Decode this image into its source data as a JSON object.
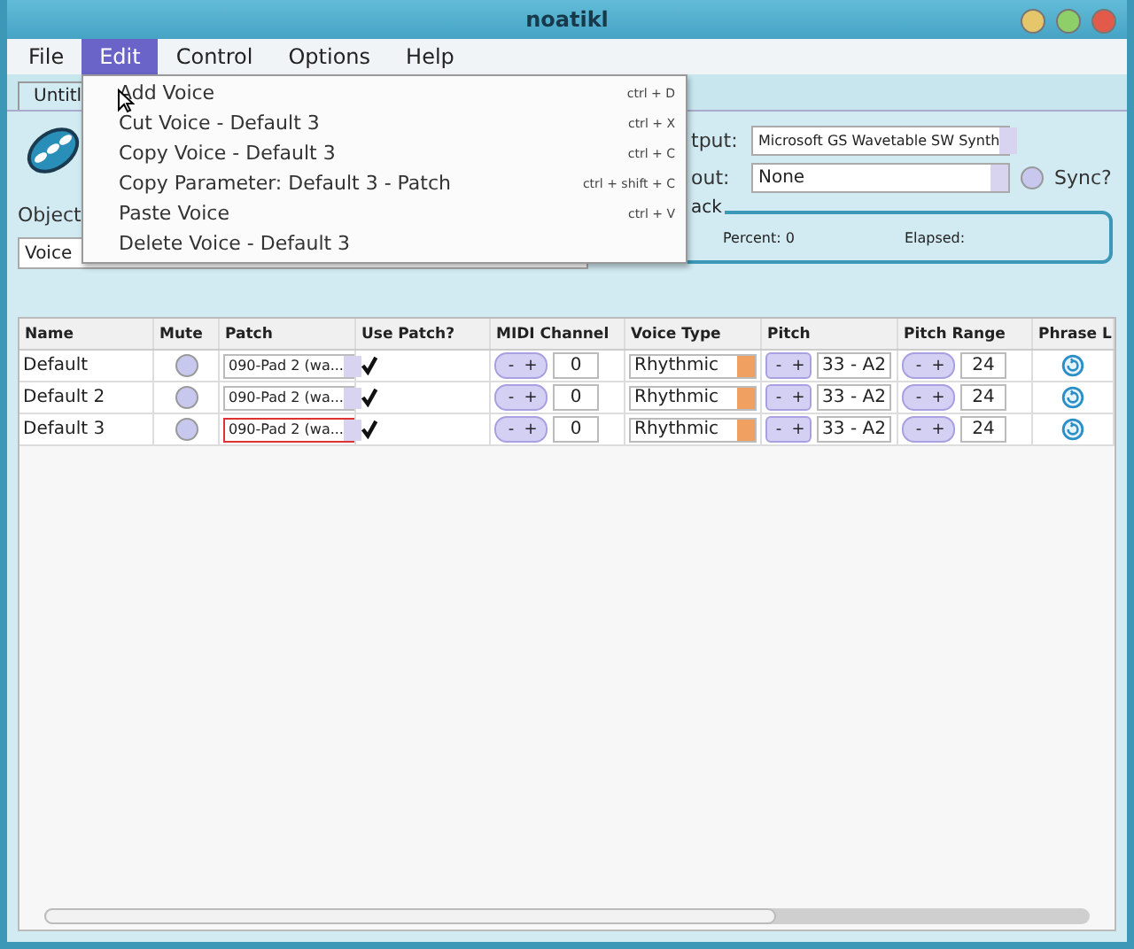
{
  "window": {
    "title": "noatikl"
  },
  "menu_bar": [
    {
      "label": "File",
      "selected": false
    },
    {
      "label": "Edit",
      "selected": true
    },
    {
      "label": "Control",
      "selected": false
    },
    {
      "label": "Options",
      "selected": false
    },
    {
      "label": "Help",
      "selected": false
    }
  ],
  "edit_menu": [
    {
      "label": "Add Voice",
      "shortcut": "ctrl + D"
    },
    {
      "label": "Cut Voice - Default 3",
      "shortcut": "ctrl + X"
    },
    {
      "label": "Copy Voice - Default 3",
      "shortcut": "ctrl + C"
    },
    {
      "label": "Copy Parameter: Default 3 - Patch",
      "shortcut": "ctrl + shift + C"
    },
    {
      "label": "Paste Voice",
      "shortcut": "ctrl + V"
    },
    {
      "label": "Delete Voice - Default 3"
    }
  ],
  "tabs": [
    {
      "label": "Untitl",
      "selected": true
    }
  ],
  "object_panel": {
    "label": "Object",
    "value": "Voice"
  },
  "output_panel": {
    "output_label": "tput:",
    "output_value": "Microsoft GS Wavetable SW Synth",
    "input_label": "out:",
    "input_value": "None",
    "sync_label": "Sync?",
    "sync": false,
    "playback": {
      "legend": "ack",
      "percent": "Percent: 0",
      "elapsed": "Elapsed:"
    }
  },
  "table": {
    "columns": [
      "Name",
      "Mute",
      "Patch",
      "Use Patch?",
      "MIDI Channel",
      "Voice Type",
      "Pitch",
      "Pitch Range",
      "Phrase L"
    ],
    "rows": [
      {
        "name": "Default",
        "muted": false,
        "patch": "090-Pad 2 (wa...",
        "patch_focused": false,
        "use_patch": true,
        "midi_spin": [
          "-",
          "+"
        ],
        "midi_channel": "0",
        "voice_type": "Rhythmic",
        "pitch_spin": [
          "-",
          "+"
        ],
        "pitch": "33 - A2",
        "range_spin": [
          "-",
          "+"
        ],
        "pitch_range": "24"
      },
      {
        "name": "Default 2",
        "muted": false,
        "patch": "090-Pad 2 (wa...",
        "patch_focused": false,
        "use_patch": true,
        "midi_spin": [
          "-",
          "+"
        ],
        "midi_channel": "0",
        "voice_type": "Rhythmic",
        "pitch_spin": [
          "-",
          "+"
        ],
        "pitch": "33 - A2",
        "range_spin": [
          "-",
          "+"
        ],
        "pitch_range": "24"
      },
      {
        "name": "Default 3",
        "muted": false,
        "patch": "090-Pad 2 (wa...",
        "patch_focused": true,
        "use_patch": true,
        "midi_spin": [
          "-",
          "+"
        ],
        "midi_channel": "0",
        "voice_type": "Rhythmic",
        "pitch_spin": [
          "-",
          "+"
        ],
        "pitch": "33 - A2",
        "range_spin": [
          "-",
          "+"
        ],
        "pitch_range": "24"
      }
    ]
  }
}
